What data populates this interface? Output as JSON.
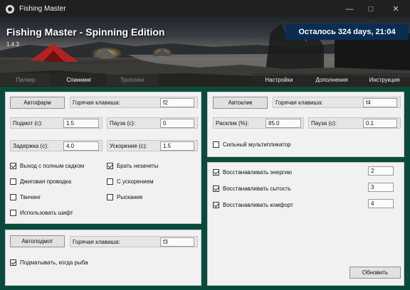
{
  "window": {
    "title": "Fishing Master"
  },
  "banner": {
    "title": "Fishing Master - Spinning Edition",
    "version": "1.4.3",
    "time_left": "Осталось 324 days, 21:04"
  },
  "tabs": {
    "left": [
      {
        "label": "Пилкер"
      },
      {
        "label": "Спиннинг"
      },
      {
        "label": "Троллинг"
      }
    ],
    "right": [
      {
        "label": "Настройки"
      },
      {
        "label": "Дополнения"
      },
      {
        "label": "Инструкция"
      }
    ]
  },
  "autofarm": {
    "button": "Автофарм",
    "hotkey_label": "Горячая клавиша:",
    "hotkey_value": "f2",
    "fields": [
      {
        "label": "Подмот (с):",
        "value": "1.5"
      },
      {
        "label": "Пауза (с):",
        "value": "0"
      },
      {
        "label": "Задержка (с):",
        "value": "4.0"
      },
      {
        "label": "Ускорение (с):",
        "value": "1.5"
      }
    ],
    "checkboxes": [
      {
        "label": "Выход с полным садком",
        "checked": true
      },
      {
        "label": "Брать незачеты",
        "checked": true
      },
      {
        "label": "Джиговая проводка",
        "checked": false
      },
      {
        "label": "С ускорением",
        "checked": false
      },
      {
        "label": "Твичинг",
        "checked": false
      },
      {
        "label": "Рыскание",
        "checked": false
      },
      {
        "label": "Использовать шифт",
        "checked": false
      }
    ]
  },
  "autoclick": {
    "button": "Автоклик",
    "hotkey_label": "Горячая клавиша:",
    "hotkey_value": "f4",
    "fields": [
      {
        "label": "Расклик (%):",
        "value": "85.0"
      },
      {
        "label": "Пауза (с):",
        "value": "0.1"
      }
    ],
    "checkbox": {
      "label": "Сильный мультипликатор",
      "checked": false
    }
  },
  "restore": {
    "items": [
      {
        "label": "Восстанавливать энергию",
        "checked": true,
        "value": "2"
      },
      {
        "label": "Восстанавливать сытость",
        "checked": true,
        "value": "3"
      },
      {
        "label": "Восстанавливать комфорт",
        "checked": true,
        "value": "4"
      }
    ],
    "update_button": "Обновить"
  },
  "autohook": {
    "button": "Автоподмот",
    "hotkey_label": "Горячая клавиша:",
    "hotkey_value": "f3",
    "checkbox": {
      "label": "Подматывать, когда рыба",
      "checked": true
    }
  }
}
